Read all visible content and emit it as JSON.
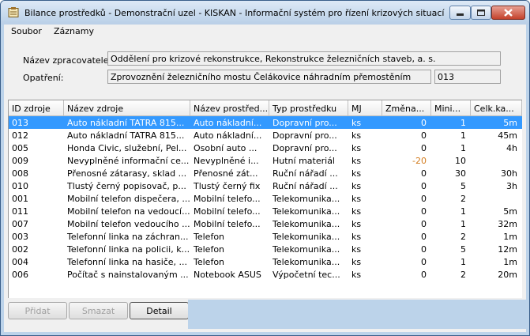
{
  "window": {
    "title": "Bilance prostředků - Demonstrační uzel - KISKAN - Informační systém pro řízení krizových situací",
    "icon": "clipboard-icon",
    "controls": {
      "minimize": "minimize-icon",
      "maximize": "maximize-icon",
      "close": "close-icon"
    },
    "accent_color": "#3399ff",
    "close_color": "#c4412b"
  },
  "menu": {
    "items": [
      {
        "label": "Soubor"
      },
      {
        "label": "Záznamy"
      }
    ]
  },
  "form": {
    "processor_label": "Název zpracovatele:",
    "processor_value": "Oddělení pro krizové rekonstrukce, Rekonstrukce železničních staveb, a. s.",
    "measure_label": "Opatření:",
    "measure_value": "Zprovoznění železničního mostu Čelákovice náhradním přemostěním",
    "measure_code": "013"
  },
  "table": {
    "columns": [
      {
        "label": "ID zdroje"
      },
      {
        "label": "Název zdroje"
      },
      {
        "label": "Název prostřed..."
      },
      {
        "label": "Typ prostředku"
      },
      {
        "label": "MJ"
      },
      {
        "label": "Změna..."
      },
      {
        "label": "Mini..."
      },
      {
        "label": "Celk.ka..."
      }
    ],
    "rows": [
      {
        "id": "013",
        "name": "Auto nákladní TATRA  815...",
        "resource": "Auto nákladní...",
        "type": "Dopravní pro...",
        "mj": "ks",
        "change": "0",
        "min": "1",
        "total": "5m",
        "selected": true
      },
      {
        "id": "012",
        "name": "Auto nákladní TATRA  815...",
        "resource": "Auto nákladní...",
        "type": "Dopravní pro...",
        "mj": "ks",
        "change": "0",
        "min": "1",
        "total": "45m"
      },
      {
        "id": "005",
        "name": "Honda Civic, služební, Pel...",
        "resource": "Osobní auto ...",
        "type": "Dopravní pro...",
        "mj": "ks",
        "change": "0",
        "min": "1",
        "total": "4h"
      },
      {
        "id": "009",
        "name": "Nevyplněné informační ce...",
        "resource": "Nevyplněné i...",
        "type": "Hutní materiál",
        "mj": "ks",
        "change": "-20",
        "min": "10",
        "total": ""
      },
      {
        "id": "008",
        "name": "Přenosné zátarasy, sklad ...",
        "resource": "Přenosné zát...",
        "type": "Ruční nářadí ...",
        "mj": "ks",
        "change": "0",
        "min": "30",
        "total": "30h"
      },
      {
        "id": "010",
        "name": "Tlustý černý popisovač, p...",
        "resource": "Tlustý černý fix",
        "type": "Ruční nářadí ...",
        "mj": "ks",
        "change": "0",
        "min": "5",
        "total": "3h"
      },
      {
        "id": "001",
        "name": "Mobilní telefon dispečera, ...",
        "resource": "Mobilní telefo...",
        "type": "Telekomunika...",
        "mj": "ks",
        "change": "0",
        "min": "2",
        "total": ""
      },
      {
        "id": "011",
        "name": "Mobilní telefon na vedoucí...",
        "resource": "Mobilní telefo...",
        "type": "Telekomunika...",
        "mj": "ks",
        "change": "0",
        "min": "1",
        "total": "5m"
      },
      {
        "id": "007",
        "name": "Mobilní telefon vedoucího ...",
        "resource": "Mobilní telefo...",
        "type": "Telekomunika...",
        "mj": "ks",
        "change": "0",
        "min": "1",
        "total": "32m"
      },
      {
        "id": "003",
        "name": "Telefonní linka na záchran...",
        "resource": "Telefon",
        "type": "Telekomunika...",
        "mj": "ks",
        "change": "0",
        "min": "2",
        "total": "1m"
      },
      {
        "id": "002",
        "name": "Telefonní linka na policii, k...",
        "resource": "Telefon",
        "type": "Telekomunika...",
        "mj": "ks",
        "change": "0",
        "min": "5",
        "total": "12m"
      },
      {
        "id": "004",
        "name": "Telefonní linka na hasiče, ...",
        "resource": "Telefon",
        "type": "Telekomunika...",
        "mj": "ks",
        "change": "0",
        "min": "1",
        "total": "1m"
      },
      {
        "id": "006",
        "name": "Počítač s nainstalovaným ...",
        "resource": "Notebook ASUS",
        "type": "Výpočetní tec...",
        "mj": "ks",
        "change": "0",
        "min": "2",
        "total": "20m"
      }
    ]
  },
  "buttons": {
    "add": "Přidat",
    "delete": "Smazat",
    "detail": "Detail"
  }
}
